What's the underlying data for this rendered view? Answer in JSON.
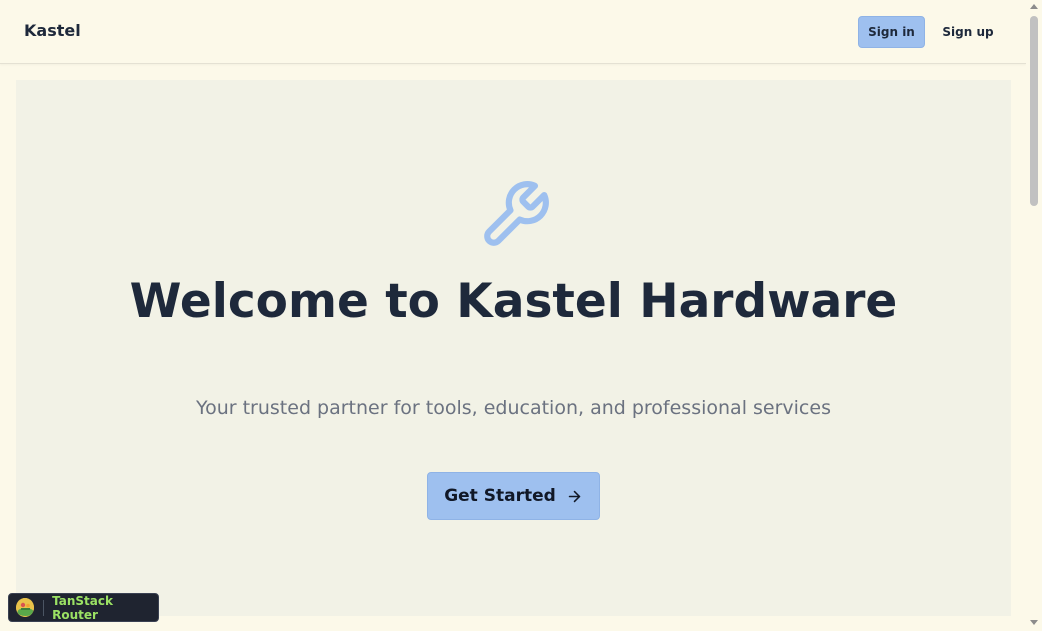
{
  "header": {
    "brand": "Kastel",
    "sign_in_label": "Sign in",
    "sign_up_label": "Sign up"
  },
  "hero": {
    "icon": "wrench-icon",
    "title": "Welcome to Kastel Hardware",
    "subtitle": "Your trusted partner for tools, education, and professional services",
    "cta_label": "Get Started",
    "cta_icon": "arrow-right-icon"
  },
  "devtools": {
    "label": "TanStack Router",
    "icon": "tanstack-logo-icon"
  },
  "colors": {
    "page_background": "#fcf9e9",
    "hero_background": "#f2f2e6",
    "accent": "#9ec0ef",
    "title": "#1e293b",
    "subtitle": "#6b7280",
    "devtools_label": "#9be264"
  }
}
